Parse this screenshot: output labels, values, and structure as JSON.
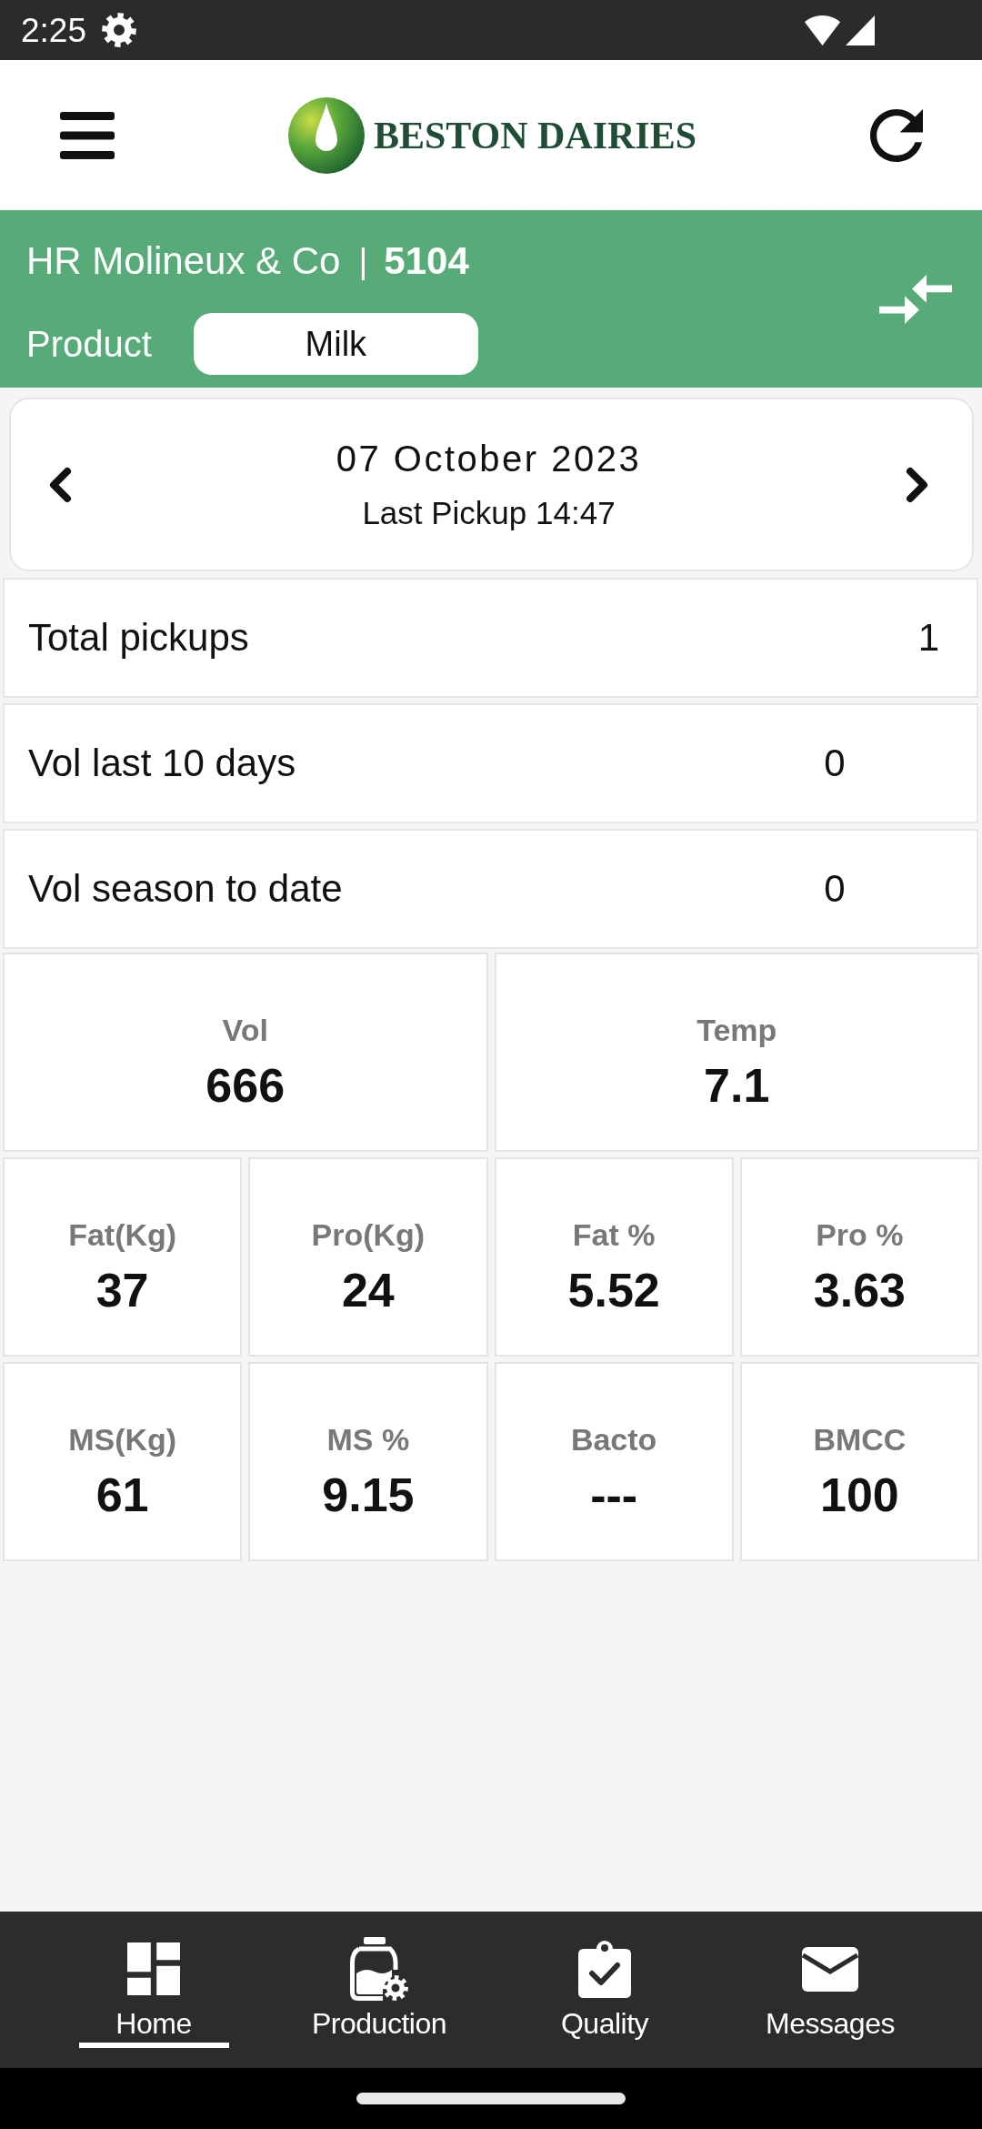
{
  "status_bar": {
    "time": "2:25"
  },
  "header": {
    "brand": "BESTON DAIRIES"
  },
  "supplier": {
    "name": "HR Molineux & Co",
    "separator": "|",
    "number": "5104",
    "product_label": "Product",
    "product": "Milk"
  },
  "date_nav": {
    "date": "07 October 2023",
    "last_pickup": "Last Pickup 14:47"
  },
  "summary_rows": [
    {
      "kind": "count",
      "label": "Total pickups",
      "value": "1"
    },
    {
      "kind": "volume",
      "label": "Vol last 10 days",
      "value": "0"
    },
    {
      "kind": "volume",
      "label": "Vol season to date",
      "value": "0"
    }
  ],
  "stat_rows": [
    {
      "tiles": [
        {
          "label": "Vol",
          "value": "666"
        },
        {
          "label": "Temp",
          "value": "7.1"
        }
      ]
    },
    {
      "tiles": [
        {
          "label": "Fat(Kg)",
          "value": "37"
        },
        {
          "label": "Pro(Kg)",
          "value": "24"
        },
        {
          "label": "Fat %",
          "value": "5.52"
        },
        {
          "label": "Pro %",
          "value": "3.63"
        }
      ]
    },
    {
      "tiles": [
        {
          "label": "MS(Kg)",
          "value": "61"
        },
        {
          "label": "MS %",
          "value": "9.15"
        },
        {
          "label": "Bacto",
          "value": "---"
        },
        {
          "label": "BMCC",
          "value": "100"
        }
      ]
    }
  ],
  "bottom_nav": [
    {
      "label": "Home",
      "selected": true
    },
    {
      "label": "Production",
      "selected": false
    },
    {
      "label": "Quality",
      "selected": false
    },
    {
      "label": "Messages",
      "selected": false
    }
  ]
}
